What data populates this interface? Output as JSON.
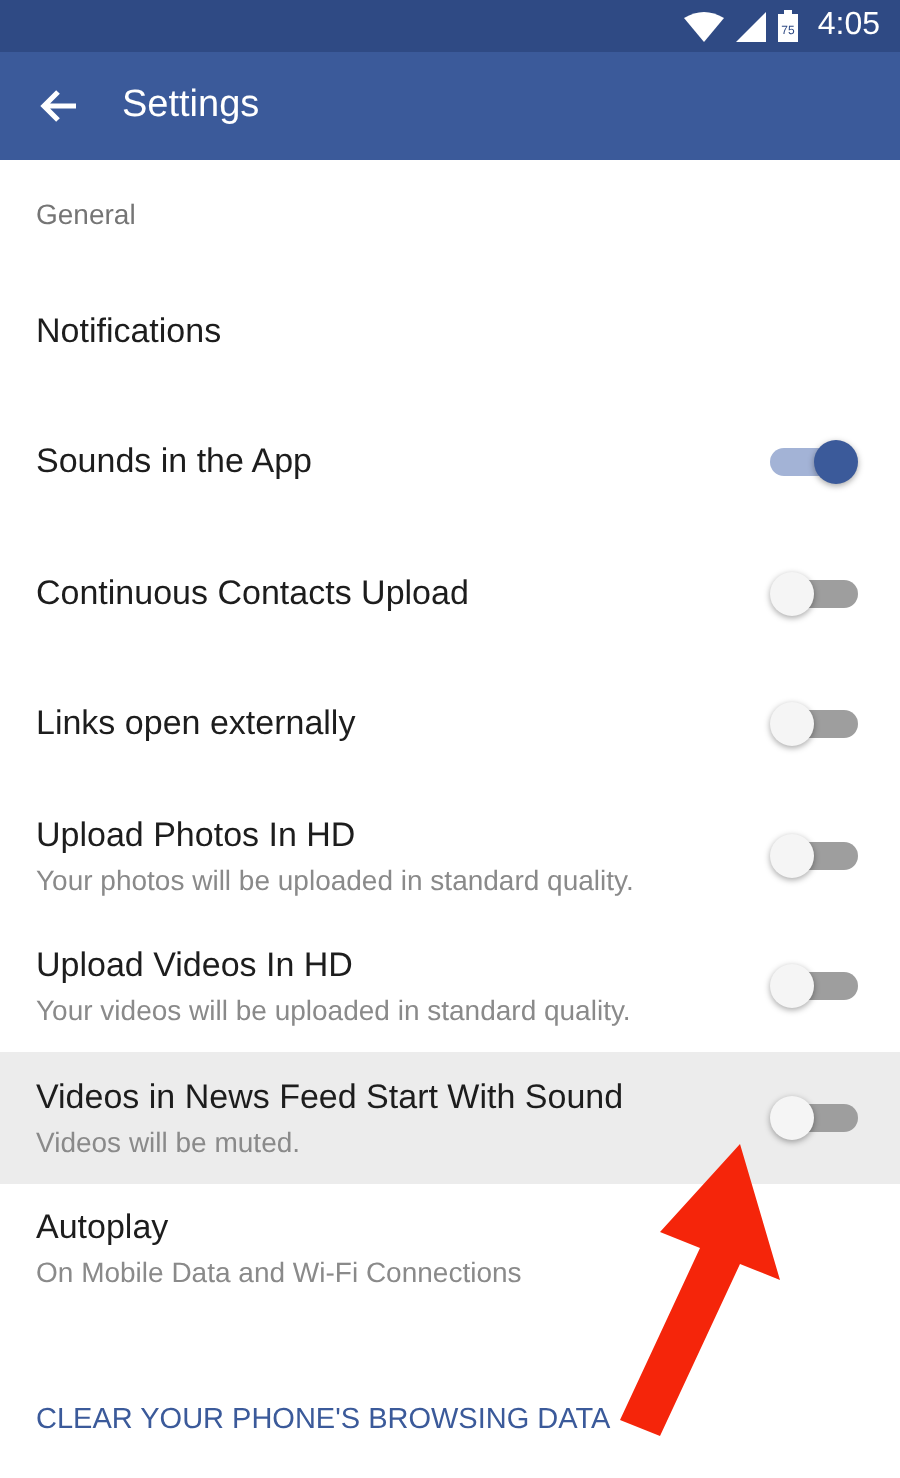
{
  "status_bar": {
    "battery_text": "75",
    "time": "4:05"
  },
  "app_bar": {
    "title": "Settings"
  },
  "section": "General",
  "rows": [
    {
      "title": "Notifications",
      "kind": "plain",
      "highlighted": false
    },
    {
      "title": "Sounds in the App",
      "kind": "toggle",
      "on": true,
      "highlighted": false
    },
    {
      "title": "Continuous Contacts Upload",
      "kind": "toggle",
      "on": false,
      "highlighted": false
    },
    {
      "title": "Links open externally",
      "kind": "toggle",
      "on": false,
      "highlighted": false
    },
    {
      "title": "Upload Photos In HD",
      "subtitle": "Your photos will be uploaded in standard quality.",
      "kind": "toggle",
      "on": false,
      "highlighted": false
    },
    {
      "title": "Upload Videos In HD",
      "subtitle": "Your videos will be uploaded in standard quality.",
      "kind": "toggle",
      "on": false,
      "highlighted": false
    },
    {
      "title": "Videos in News Feed Start With Sound",
      "subtitle": "Videos will be muted.",
      "kind": "toggle",
      "on": false,
      "highlighted": true
    },
    {
      "title": "Autoplay",
      "subtitle": "On Mobile Data and Wi-Fi Connections",
      "kind": "plain",
      "highlighted": false
    }
  ],
  "link": "CLEAR YOUR PHONE'S BROWSING DATA"
}
